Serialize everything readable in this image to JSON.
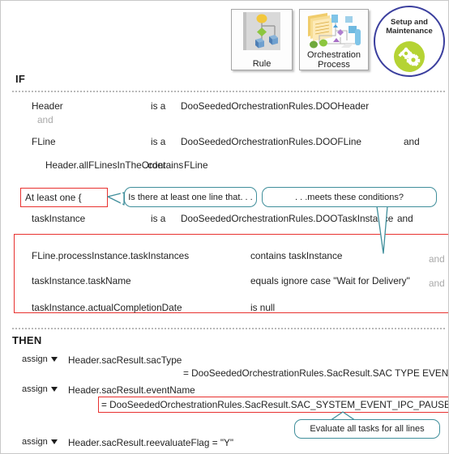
{
  "toolbar": {
    "tiles": [
      {
        "label": "Rule",
        "icon": "rule-diagram-icon"
      },
      {
        "label_line1": "Orchestration",
        "label_line2": "Process",
        "icon": "orchestration-process-icon"
      }
    ],
    "badge": {
      "line1": "Setup and",
      "line2": "Maintenance",
      "icon": "gears-icon",
      "circle_color": "#3b3f9e",
      "dot_color": "#b5d334"
    }
  },
  "rule": {
    "if_label": "IF",
    "then_label": "THEN",
    "if_rows": [
      {
        "left": "Header",
        "operator": "is a",
        "value": "DooSeededOrchestrationRules.DOOHeader",
        "trailing": ""
      },
      {
        "left": "and",
        "operator": "",
        "value": "",
        "trailing": ""
      },
      {
        "left": "FLine",
        "operator": "is a",
        "value": "DooSeededOrchestrationRules.DOOFLine",
        "trailing": "and"
      },
      {
        "left": "Header.allFLinesInTheOrder",
        "operator": ".contains",
        "value": "FLine",
        "trailing": ""
      }
    ],
    "at_least_one": "At least one  {",
    "task_instance_row": {
      "left": "taskInstance",
      "operator": "is a",
      "value": "DooSeededOrchestrationRules.DOOTaskInstance",
      "trailing": "and"
    },
    "grouped_conditions": [
      {
        "left": "FLine.processInstance.taskInstances",
        "operator": "contains taskInstance",
        "trailing": "and"
      },
      {
        "left": "taskInstance.taskName",
        "operator": "equals ignore case \"Wait for Delivery\"",
        "trailing": "and"
      },
      {
        "left": "taskInstance.actualCompletionDate",
        "operator": "is  null",
        "trailing": ""
      }
    ],
    "then_rows": [
      {
        "verb": "assign",
        "target": "Header.sacResult.sacType",
        "assignment": "= DooSeededOrchestrationRules.SacResult.SAC  TYPE  EVENT",
        "highlighted": false
      },
      {
        "verb": "assign",
        "target": "Header.sacResult.eventName",
        "assignment": "= DooSeededOrchestrationRules.SacResult.SAC_SYSTEM_EVENT_IPC_PAUSE",
        "highlighted": true
      },
      {
        "verb": "assign",
        "target": "Header.sacResult.reevaluateFlag   = \"Y\"",
        "assignment": "",
        "highlighted": false
      }
    ]
  },
  "callouts": [
    {
      "text": "Is there at least one line that. . ."
    },
    {
      "text": ". . .meets these conditions?"
    },
    {
      "text": "Evaluate  all tasks for all lines"
    }
  ],
  "colors": {
    "highlight_red": "#e8312f",
    "callout_teal": "#3f8e9b",
    "muted_gray": "#a9a9a9"
  }
}
